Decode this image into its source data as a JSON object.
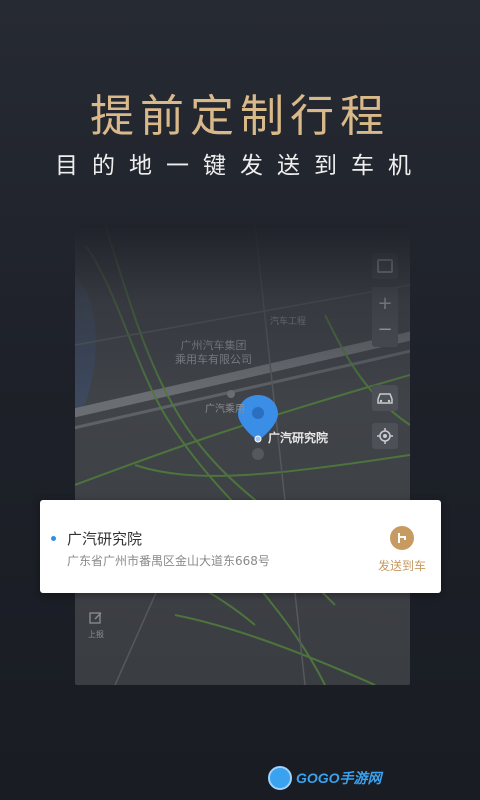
{
  "header": {
    "headline": "提前定制行程",
    "subhead": "目的地一键发送到车机"
  },
  "map": {
    "labels": {
      "company": "广州汽车集团\n乘用车有限公司",
      "partial_top": "汽车工程",
      "bus_stop": "广汽乘用",
      "poi": "广汽研究院",
      "side_label": "上报"
    },
    "controls": {
      "zoom_in": "+",
      "zoom_out": "−"
    }
  },
  "card": {
    "title": "广汽研究院",
    "address": "广东省广州市番禺区金山大道东668号",
    "send_label": "发送到车"
  },
  "watermark": {
    "text": "GOGO手游网"
  },
  "colors": {
    "headline": "#d9b98a",
    "accent_gold": "#c79a62",
    "pin_blue": "#3a8ee6",
    "road_green": "#4f7a3c"
  }
}
